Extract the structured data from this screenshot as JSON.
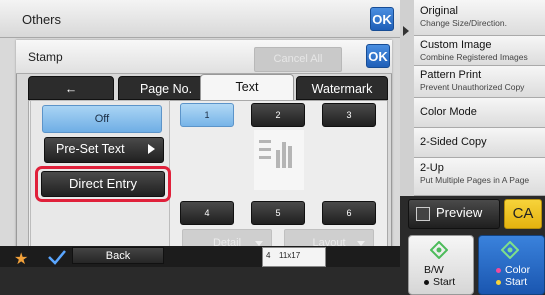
{
  "header": {
    "title": "Others",
    "ok_label": "OK"
  },
  "stamp": {
    "title": "Stamp",
    "cancel_all_label": "Cancel All",
    "ok_label": "OK",
    "tabs": [
      {
        "label": "←"
      },
      {
        "label": "Page No."
      },
      {
        "label": "Text"
      },
      {
        "label": "Watermark"
      }
    ],
    "off_label": "Off",
    "preset_label": "Pre-Set Text",
    "direct_entry_label": "Direct Entry",
    "positions": [
      "1",
      "2",
      "3",
      "4",
      "5",
      "6"
    ],
    "detail_label": "Detail",
    "layout_label": "Layout"
  },
  "bottom": {
    "back_label": "Back",
    "paper_tray": "4",
    "paper_size": "11x17"
  },
  "functions": [
    {
      "title": "Original",
      "subtitle": "Change Size/Direction."
    },
    {
      "title": "Custom Image",
      "subtitle": "Combine Registered Images"
    },
    {
      "title": "Pattern Print",
      "subtitle": "Prevent Unauthorized Copy"
    },
    {
      "title": "Color Mode",
      "subtitle": ""
    },
    {
      "title": "2-Sided Copy",
      "subtitle": ""
    },
    {
      "title": "2-Up",
      "subtitle": "Put Multiple Pages in A Page"
    }
  ],
  "actions": {
    "preview_label": "Preview",
    "ca_label": "CA",
    "bw_label_1": "B/W",
    "bw_label_2": "Start",
    "color_label_1": "Color",
    "color_label_2": "Start"
  },
  "colors": {
    "accent_blue": "#1f5fb8",
    "highlight_red": "#e0203a",
    "ca_yellow": "#f2c31f"
  }
}
